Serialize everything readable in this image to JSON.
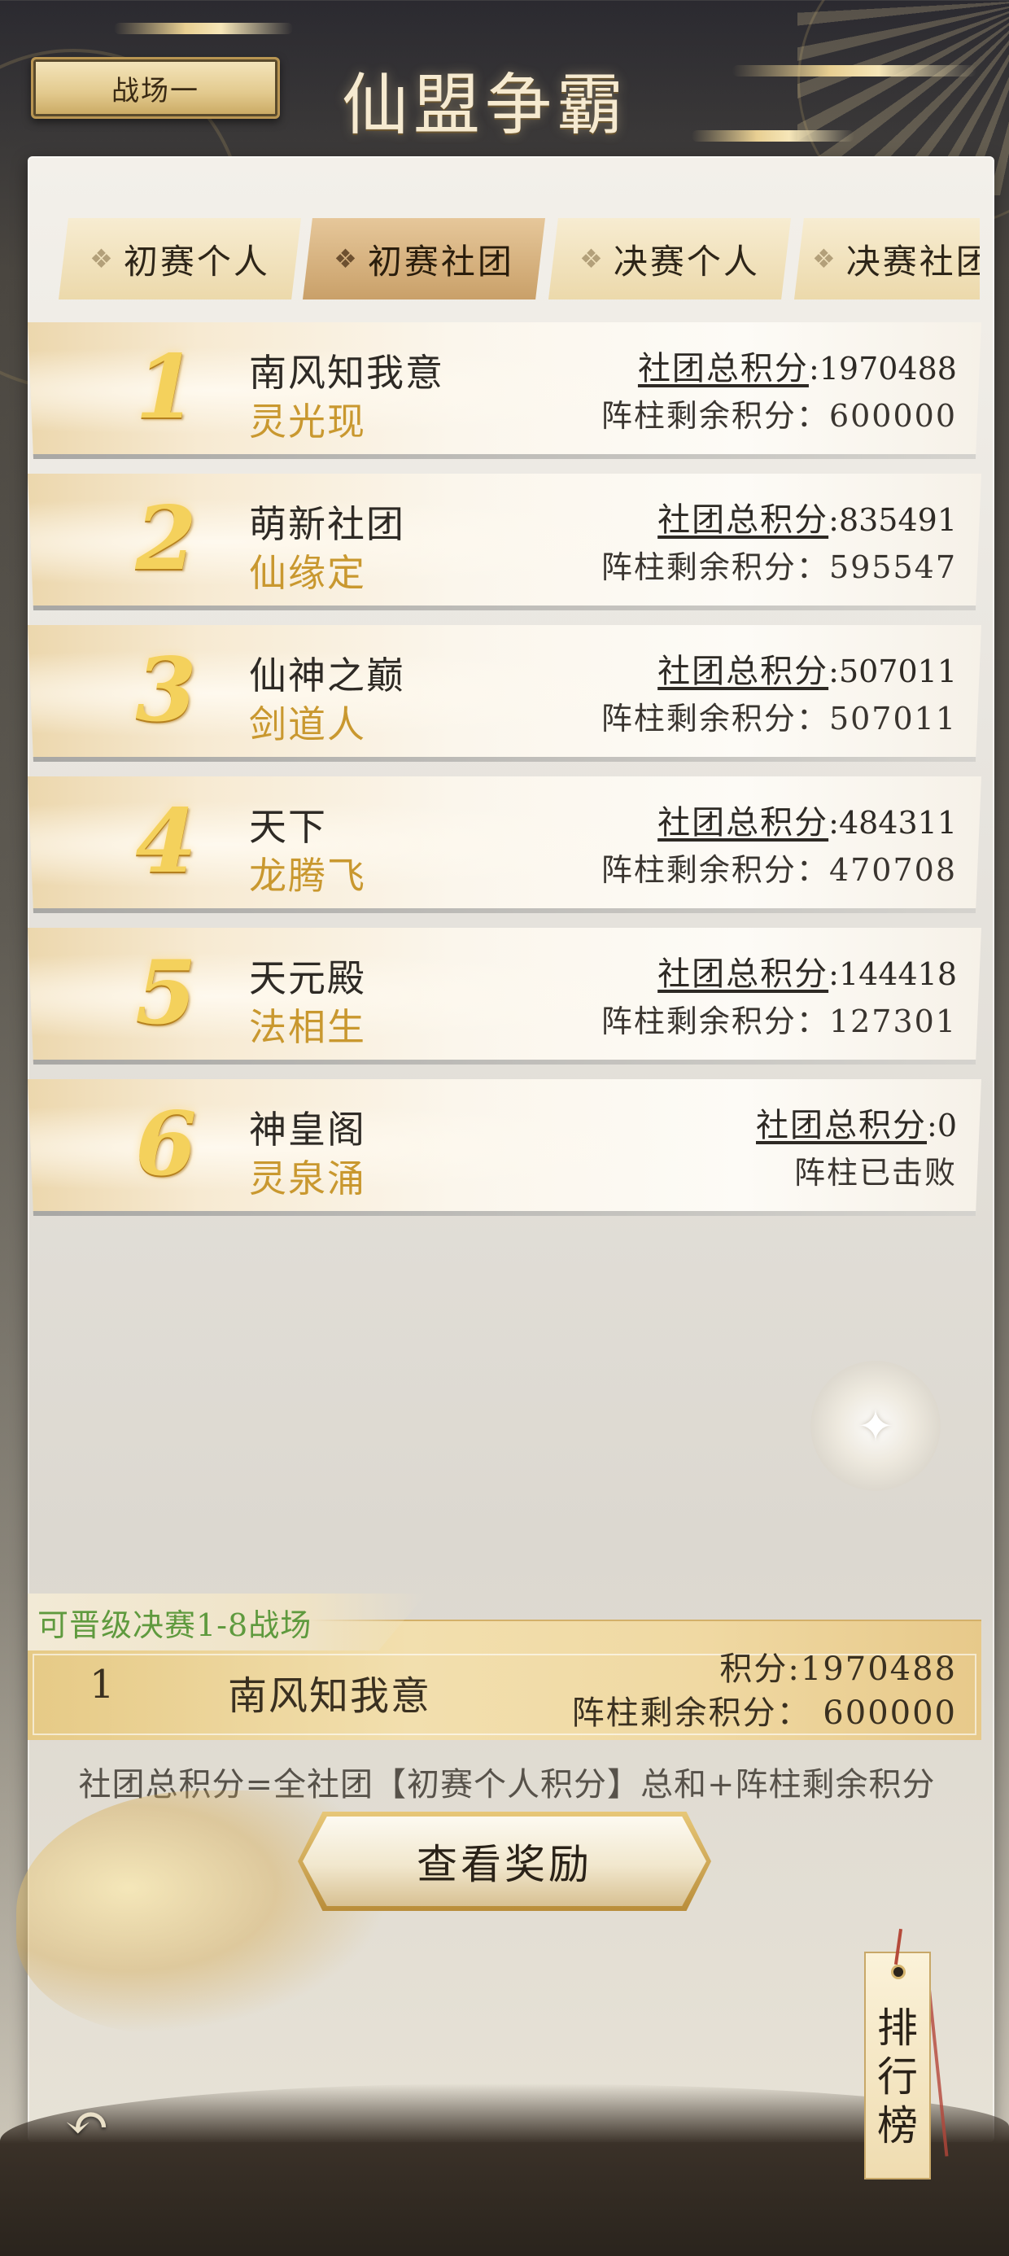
{
  "header": {
    "battlefield": "战场一",
    "title": "仙盟争霸"
  },
  "tabs": [
    {
      "label": "初赛个人",
      "active": false
    },
    {
      "label": "初赛社团",
      "active": true
    },
    {
      "label": "决赛个人",
      "active": false
    },
    {
      "label": "决赛社团",
      "active": false
    }
  ],
  "score_label": "社团总积分",
  "pillar_label": "阵柱剩余积分：",
  "rankings": [
    {
      "rank": "1",
      "club": "南风知我意",
      "leader": "灵光现",
      "total": "1970488",
      "pillar_text": "600000"
    },
    {
      "rank": "2",
      "club": "萌新社团",
      "leader": "仙缘定",
      "total": "835491",
      "pillar_text": "595547"
    },
    {
      "rank": "3",
      "club": "仙神之巅",
      "leader": "剑道人",
      "total": "507011",
      "pillar_text": "507011"
    },
    {
      "rank": "4",
      "club": "天下",
      "leader": "龙腾飞",
      "total": "484311",
      "pillar_text": "470708"
    },
    {
      "rank": "5",
      "club": "天元殿",
      "leader": "法相生",
      "total": "144418",
      "pillar_text": "127301"
    },
    {
      "rank": "6",
      "club": "神皇阁",
      "leader": "灵泉涌",
      "total": "0",
      "pillar_text": "阵柱已击败"
    }
  ],
  "my_club": {
    "qualify_tag": "可晋级决赛1-8战场",
    "rank": "1",
    "club": "南风知我意",
    "score": "积分:1970488",
    "pillar": "阵柱剩余积分： 600000"
  },
  "formula": "社团总积分=全社团【初赛个人积分】总和+阵柱剩余积分",
  "reward_button": "查看奖励",
  "leaderboard_tag": [
    "排",
    "行",
    "榜"
  ],
  "icons": {
    "back": "back-arrow-icon",
    "seal": "sparkle-seal-icon"
  },
  "colors": {
    "leader_gold": "#c9982f",
    "qualify_green": "#5f9a3e",
    "rank_gold": "#f4d15c"
  }
}
